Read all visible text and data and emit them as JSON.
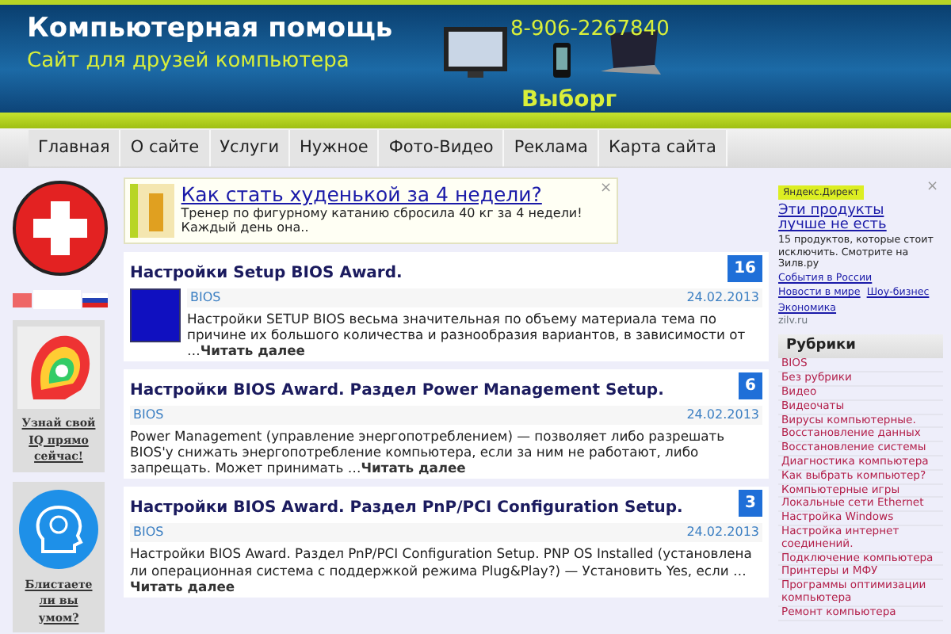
{
  "header": {
    "title": "Компьютерная помощь",
    "subtitle": "Сайт для друзей компьютера",
    "phone": "8-906-2267840",
    "city": "Выборг"
  },
  "nav": [
    "Главная",
    "О сайте",
    "Услуги",
    "Нужное",
    "Фото-Видео",
    "Реклама",
    "Карта сайта"
  ],
  "left_sidebar": {
    "promos": [
      {
        "link": "Узнай свой IQ прямо сейчас!",
        "kind": "iq"
      },
      {
        "link": "Блистаете ли вы умом?",
        "kind": "head"
      }
    ]
  },
  "ad": {
    "title": "Как стать худенькой за 4 недели?",
    "text": "Тренер по фигурному катанию сбросила 40 кг за 4 недели! Каждый день она..",
    "close": "×"
  },
  "posts": [
    {
      "title": "Настройки Setup BIOS Award.",
      "comments": "16",
      "category": "BIOS",
      "date": "24.02.2013",
      "thumbnail": true,
      "excerpt": "Настройки SETUP BIOS весьма значительная по объему материала тема по причине их большого количества и разнообразия вариантов, в зависимости от …",
      "read_more": "Читать далее"
    },
    {
      "title": "Настройки BIOS Award. Раздел Power Management Setup.",
      "comments": "6",
      "category": "BIOS",
      "date": "24.02.2013",
      "thumbnail": false,
      "excerpt": "Power Management (управление энергопотреблением) — позволяет либо разрешать BIOS'у снижать энергопотребление компьютера, если за ним не работают, либо запрещать. Может принимать …",
      "read_more": "Читать далее"
    },
    {
      "title": "Настройки BIOS Award. Раздел PnP/PCI Configuration Setup.",
      "comments": "3",
      "category": "BIOS",
      "date": "24.02.2013",
      "thumbnail": false,
      "excerpt": "Настройки BIOS Award. Раздел PnP/PCI Configuration Setup. PNP OS Installed (установлена ли операционная система с поддержкой режима Plug&Play?) — Установить Yes, если …",
      "read_more": "Читать далее"
    }
  ],
  "right_sidebar": {
    "direct": {
      "label": "Яндекс.Директ",
      "title": "Эти продукты лучше не есть",
      "close": "×",
      "text": "15 продуктов, которые стоит исключить. Смотрите на Зилв.ру",
      "links": [
        "События в России",
        "Новости в мире",
        "Шоу-бизнес",
        "Экономика"
      ],
      "domain": "zilv.ru"
    },
    "rubrics": {
      "title": "Рубрики",
      "items": [
        "BIOS",
        "Без рубрики",
        "Видео",
        "Видеочаты",
        "Вирусы компьютерные.",
        "Восстановление данных",
        "Восстановление системы",
        "Диагностика компьютера",
        "Как выбрать компьютер?",
        "Компьютерные игры",
        "Локальные сети Ethernet",
        "Настройка Windows",
        "Настройка интернет соединений.",
        "Подключение компьютера",
        "Принтеры и МФУ",
        "Программы оптимизации компьютера",
        "Ремонт компьютера"
      ]
    }
  }
}
